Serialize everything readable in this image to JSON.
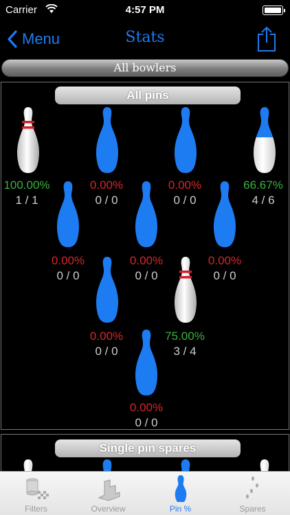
{
  "status": {
    "carrier": "Carrier",
    "time": "4:57 PM"
  },
  "nav": {
    "back_label": "Menu",
    "title": "Stats"
  },
  "bowler_filter": "All bowlers",
  "sections": {
    "all_pins": "All pins",
    "single_pin_spares": "Single pin spares"
  },
  "pins": [
    {
      "pin": 7,
      "pct": "100.00%",
      "count": "1 / 1",
      "status": "standing"
    },
    {
      "pin": 8,
      "pct": "0.00%",
      "count": "0 / 0",
      "status": "down"
    },
    {
      "pin": 9,
      "pct": "0.00%",
      "count": "0 / 0",
      "status": "down"
    },
    {
      "pin": 10,
      "pct": "66.67%",
      "count": "4 / 6",
      "status": "partial"
    },
    {
      "pin": 4,
      "pct": "0.00%",
      "count": "0 / 0",
      "status": "down"
    },
    {
      "pin": 5,
      "pct": "0.00%",
      "count": "0 / 0",
      "status": "down"
    },
    {
      "pin": 6,
      "pct": "0.00%",
      "count": "0 / 0",
      "status": "down"
    },
    {
      "pin": 2,
      "pct": "0.00%",
      "count": "0 / 0",
      "status": "down"
    },
    {
      "pin": 3,
      "pct": "75.00%",
      "count": "3 / 4",
      "status": "standing"
    },
    {
      "pin": 1,
      "pct": "0.00%",
      "count": "0 / 0",
      "status": "down"
    }
  ],
  "colors": {
    "accent": "#1e7cf2",
    "positive": "#39b33b",
    "negative": "#d8262c"
  },
  "tabs": [
    {
      "label": "Filters",
      "icon": "filters-icon",
      "active": false
    },
    {
      "label": "Overview",
      "icon": "overview-icon",
      "active": false
    },
    {
      "label": "Pin %",
      "icon": "pin-icon",
      "active": true
    },
    {
      "label": "Spares",
      "icon": "spares-icon",
      "active": false
    }
  ]
}
